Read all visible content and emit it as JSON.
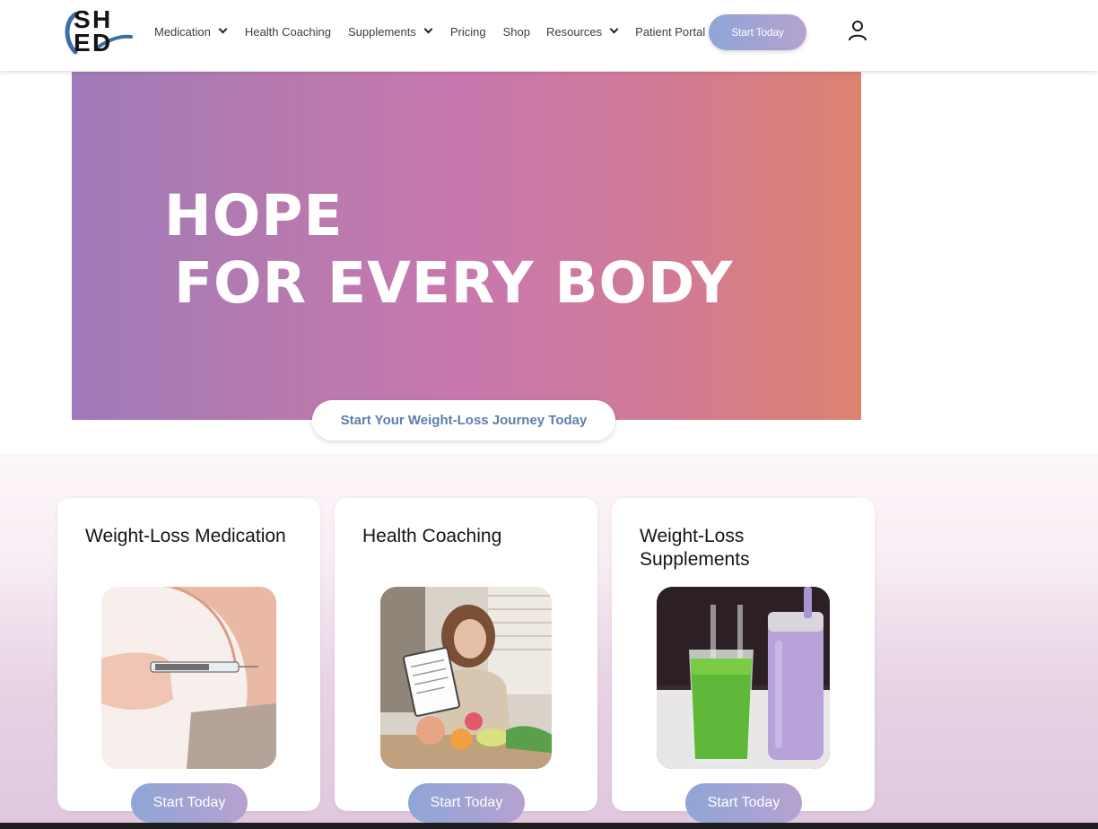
{
  "header": {
    "logo_text": "SHED",
    "nav": [
      {
        "label": "Medication",
        "dropdown": true
      },
      {
        "label": "Health Coaching",
        "dropdown": false
      },
      {
        "label": "Supplements",
        "dropdown": true
      },
      {
        "label": "Pricing",
        "dropdown": false
      },
      {
        "label": "Shop",
        "dropdown": false
      },
      {
        "label": "Resources",
        "dropdown": true
      },
      {
        "label": "Patient Portal",
        "dropdown": false
      }
    ],
    "cta_label": "Start Today",
    "account_icon": "user-icon"
  },
  "hero": {
    "line1": "HOPE",
    "line2": "FOR EVERY BODY",
    "cta_label": "Start Your Weight-Loss Journey Today",
    "colors": {
      "start": "#a07ab8",
      "mid": "#c878ae",
      "end": "#dd8270"
    }
  },
  "cards": [
    {
      "title": "Weight-Loss Medication",
      "button_label": "Start Today",
      "image": "injection-photo"
    },
    {
      "title": "Health Coaching",
      "button_label": "Start Today",
      "image": "coaching-photo"
    },
    {
      "title": "Weight-Loss Supplements",
      "button_label": "Start Today",
      "image": "smoothie-photo"
    }
  ],
  "colors": {
    "button_gradient_start": "#8fa6d6",
    "button_gradient_end": "#b6a1d0",
    "accent_text": "#5b7fae"
  }
}
